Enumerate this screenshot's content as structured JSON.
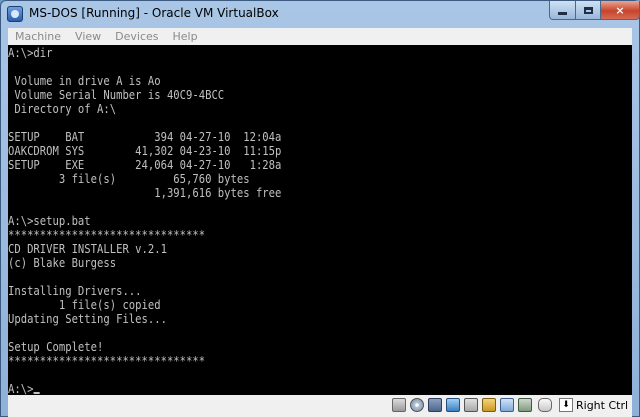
{
  "window": {
    "title": "MS-DOS [Running] - Oracle VM VirtualBox",
    "icon": "virtualbox-icon",
    "controls": {
      "minimize": "minimize-icon",
      "maximize": "maximize-icon",
      "close": "×"
    }
  },
  "menubar": {
    "items": [
      "Machine",
      "View",
      "Devices",
      "Help"
    ]
  },
  "console": {
    "lines": [
      "A:\\>dir",
      "",
      " Volume in drive A is Ao",
      " Volume Serial Number is 40C9-4BCC",
      " Directory of A:\\",
      "",
      "SETUP    BAT           394 04-27-10  12:04a",
      "OAKCDROM SYS        41,302 04-23-10  11:15p",
      "SETUP    EXE        24,064 04-27-10   1:28a",
      "        3 file(s)         65,760 bytes",
      "                       1,391,616 bytes free",
      "",
      "A:\\>setup.bat",
      "*******************************",
      "CD DRIVER INSTALLER v.2.1",
      "(c) Blake Burgess",
      "",
      "Installing Drivers...",
      "        1 file(s) copied",
      "Updating Setting Files...",
      "",
      "Setup Complete!",
      "*******************************",
      "",
      "A:\\>"
    ],
    "text_color": "#c0c0c0",
    "background": "#000000"
  },
  "statusbar": {
    "icons": [
      "hard-disk-icon",
      "optical-drive-icon",
      "floppy-icon",
      "network-icon",
      "usb-icon",
      "shared-folders-icon",
      "display-icon",
      "cpu-icon",
      "mouse-integration-icon"
    ],
    "host_key_arrow": "⬇",
    "host_key": "Right Ctrl"
  }
}
